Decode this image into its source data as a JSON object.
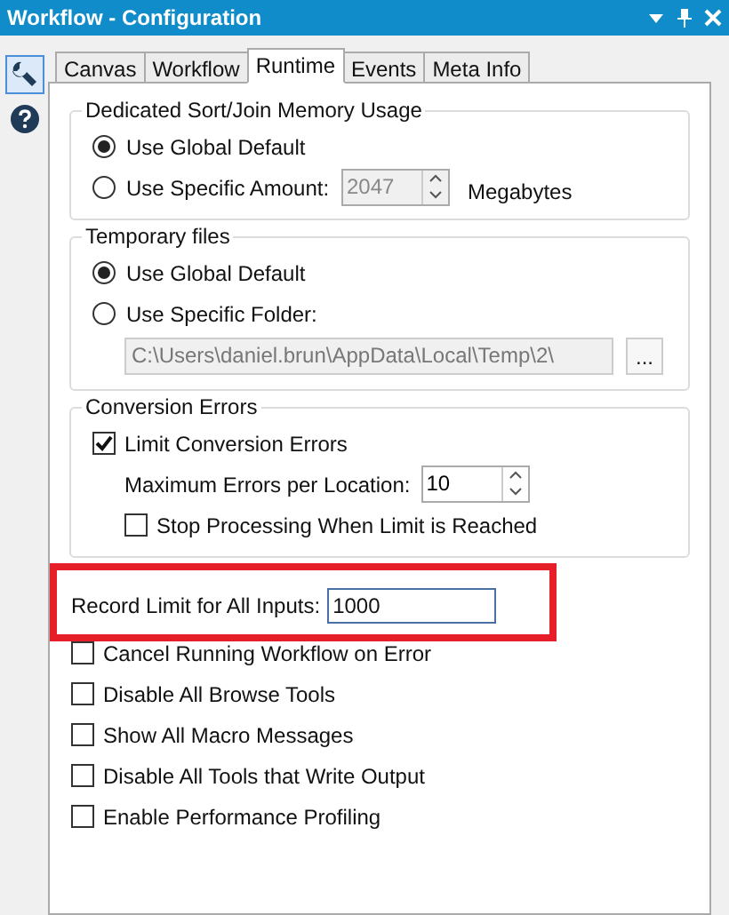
{
  "window": {
    "title": "Workflow - Configuration"
  },
  "tabs": [
    {
      "label": "Canvas",
      "selected": false
    },
    {
      "label": "Workflow",
      "selected": false
    },
    {
      "label": "Runtime",
      "selected": true
    },
    {
      "label": "Events",
      "selected": false
    },
    {
      "label": "Meta Info",
      "selected": false
    }
  ],
  "memory_group": {
    "title": "Dedicated Sort/Join Memory Usage",
    "options": [
      {
        "label": "Use Global Default",
        "selected": true
      },
      {
        "label": "Use Specific Amount:",
        "selected": false
      }
    ],
    "amount": "2047",
    "unit": "Megabytes"
  },
  "temp_group": {
    "title": "Temporary files",
    "options": [
      {
        "label": "Use Global Default",
        "selected": true
      },
      {
        "label": "Use Specific Folder:",
        "selected": false
      }
    ],
    "folder": "C:\\Users\\daniel.brun\\AppData\\Local\\Temp\\2\\",
    "browse_button": "..."
  },
  "conversion_group": {
    "title": "Conversion Errors",
    "limit": {
      "label": "Limit Conversion Errors",
      "checked": true
    },
    "max_label": "Maximum Errors per Location:",
    "max_value": "10",
    "stop": {
      "label": "Stop Processing When Limit is Reached",
      "checked": false
    }
  },
  "record_limit": {
    "label": "Record Limit for All Inputs:",
    "value": "1000"
  },
  "options": [
    {
      "label": "Cancel Running Workflow on Error",
      "checked": false
    },
    {
      "label": "Disable All Browse Tools",
      "checked": false
    },
    {
      "label": "Show All Macro Messages",
      "checked": false
    },
    {
      "label": "Disable All Tools that Write Output",
      "checked": false
    },
    {
      "label": "Enable Performance Profiling",
      "checked": false
    }
  ]
}
